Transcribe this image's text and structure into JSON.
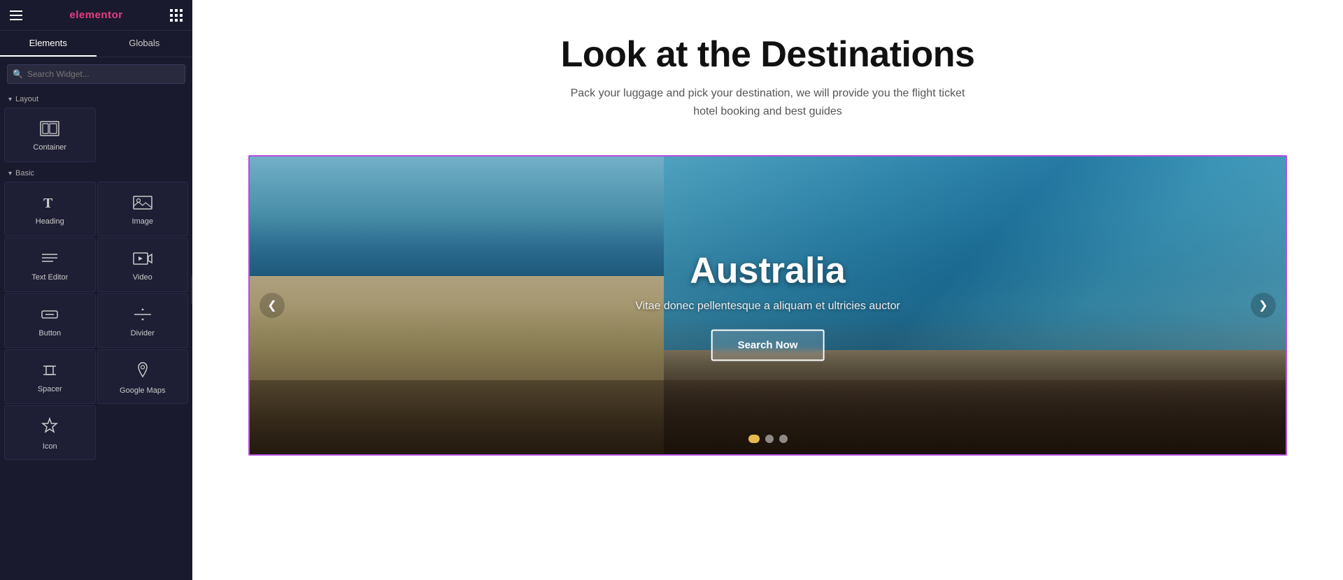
{
  "app": {
    "name": "elementor",
    "logo": "elementor"
  },
  "sidebar": {
    "tabs": [
      {
        "id": "elements",
        "label": "Elements",
        "active": true
      },
      {
        "id": "globals",
        "label": "Globals",
        "active": false
      }
    ],
    "search": {
      "placeholder": "Search Widget..."
    },
    "sections": {
      "layout": {
        "label": "Layout",
        "widgets": [
          {
            "id": "container",
            "label": "Container",
            "icon": "⊞"
          }
        ]
      },
      "basic": {
        "label": "Basic",
        "widgets": [
          {
            "id": "heading",
            "label": "Heading",
            "icon": "T"
          },
          {
            "id": "image",
            "label": "Image",
            "icon": "🖼"
          },
          {
            "id": "text-editor",
            "label": "Text Editor",
            "icon": "≡"
          },
          {
            "id": "video",
            "label": "Video",
            "icon": "▷"
          },
          {
            "id": "button",
            "label": "Button",
            "icon": "⬚"
          },
          {
            "id": "divider",
            "label": "Divider",
            "icon": "—"
          },
          {
            "id": "spacer",
            "label": "Spacer",
            "icon": "↕"
          },
          {
            "id": "google-maps",
            "label": "Google Maps",
            "icon": "📍"
          },
          {
            "id": "icon",
            "label": "Icon",
            "icon": "✦"
          }
        ]
      }
    }
  },
  "canvas": {
    "section": {
      "title": "Look at the Destinations",
      "subtitle_line1": "Pack your luggage and pick your destination, we will provide you the flight ticket",
      "subtitle_line2": "hotel booking and best guides"
    },
    "slider": {
      "current_slide": {
        "country": "Australia",
        "description": "Vitae donec pellentesque a aliquam et ultricies auctor",
        "cta_button": "Search Now"
      },
      "dots": [
        {
          "id": 1,
          "active": true
        },
        {
          "id": 2,
          "active": false
        },
        {
          "id": 3,
          "active": false
        }
      ],
      "prev_arrow": "❮",
      "next_arrow": "❯"
    }
  }
}
